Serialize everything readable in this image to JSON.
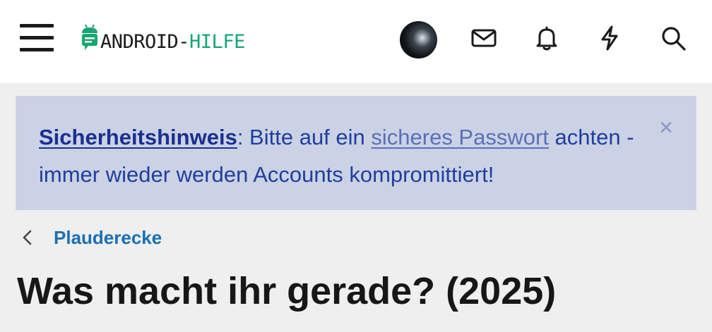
{
  "header": {
    "logo": {
      "part1": "ANDROID-",
      "part2": "HILFE",
      "brand_color": "#18a572"
    },
    "icons": [
      "menu-icon",
      "avatar",
      "mail-icon",
      "bell-icon",
      "lightning-icon",
      "search-icon"
    ]
  },
  "alert": {
    "title": "Sicherheitshinweis",
    "sep": ": Bitte auf ein ",
    "link": "sicheres Passwort",
    "rest": " achten - immer wieder werden Accounts kompromittiert!",
    "close": "×",
    "bg_color": "#cbd2e5",
    "text_color": "#1f3ea0"
  },
  "breadcrumb": {
    "label": "Plauderecke",
    "icon": "chevron-left-icon"
  },
  "page": {
    "title": "Was macht ihr gerade? (2025)"
  }
}
